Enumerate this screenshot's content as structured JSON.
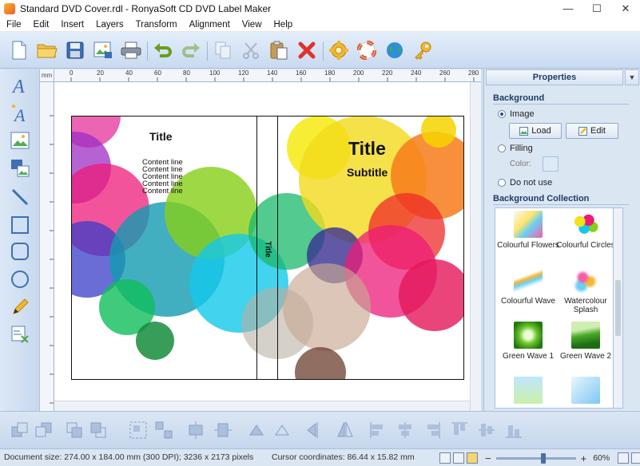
{
  "window": {
    "title": "Standard DVD Cover.rdl - RonyaSoft CD DVD Label Maker",
    "controls": [
      "—",
      "☐",
      "✕"
    ]
  },
  "menu": [
    "File",
    "Edit",
    "Insert",
    "Layers",
    "Transform",
    "Alignment",
    "View",
    "Help"
  ],
  "toolbar": {
    "items": [
      "new-document-icon",
      "open-folder-icon",
      "save-icon",
      "image-export-icon",
      "print-icon",
      "undo-icon",
      "redo-icon",
      "copy-icon",
      "cut-icon",
      "paste-icon",
      "delete-icon",
      "settings-icon",
      "help-lifebuoy-icon",
      "web-globe-icon",
      "key-register-icon"
    ]
  },
  "left_tools": [
    "text-tool-icon",
    "curved-text-tool-icon",
    "image-tool-icon",
    "picture-collection-tool-icon",
    "line-tool-icon",
    "rectangle-tool-icon",
    "rounded-rectangle-tool-icon",
    "ellipse-tool-icon",
    "pencil-tool-icon",
    "clipart-tool-icon"
  ],
  "ruler": {
    "unit": "mm",
    "h_ticks": [
      "0",
      "20",
      "40",
      "60",
      "80",
      "100",
      "120",
      "140",
      "160",
      "180",
      "200",
      "220",
      "240",
      "260",
      "280"
    ],
    "v_ticks": [
      "0",
      "20",
      "40",
      "60",
      "80",
      "100",
      "120",
      "140",
      "160",
      "180",
      "200"
    ]
  },
  "cover": {
    "back_title": "Title",
    "content_lines": [
      "Content line",
      "Content line",
      "Content line",
      "Content line",
      "Content line"
    ],
    "spine_title": "Title",
    "front_title": "Title",
    "front_subtitle": "Subtitle"
  },
  "properties": {
    "header": "Properties",
    "background_label": "Background",
    "option_image": "Image",
    "load_button": "Load",
    "edit_button": "Edit",
    "option_filling": "Filling",
    "color_label": "Color:",
    "option_none": "Do not use",
    "collection_label": "Background Collection",
    "collection": [
      {
        "name": "Colourful Flowers"
      },
      {
        "name": "Colourful Circles"
      },
      {
        "name": "Colourful Wave"
      },
      {
        "name": "Watercolour Splash"
      },
      {
        "name": "Green Wave 1"
      },
      {
        "name": "Green Wave 2"
      }
    ]
  },
  "bottom_tools": [
    "bring-to-front-icon",
    "send-to-back-icon",
    "bring-forward-icon",
    "send-backward-icon",
    "group-icon",
    "ungroup-icon",
    "center-horizontal-icon",
    "center-vertical-icon",
    "rotate-left-icon",
    "rotate-right-icon",
    "flip-horizontal-icon",
    "flip-vertical-icon",
    "align-left-icon",
    "align-center-icon",
    "align-right-icon",
    "align-top-icon",
    "align-middle-icon",
    "align-bottom-icon"
  ],
  "status": {
    "document_size": "Document size: 274.00 x 184.00 mm (300 DPI); 3236 x 2173 pixels",
    "cursor": "Cursor coordinates: 86.44 x 15.82 mm",
    "zoom": "60%",
    "zoom_minus": "−",
    "zoom_plus": "+",
    "zoom_level": 0.6
  },
  "colors": {
    "accent": "#1c3b66",
    "panel": "#dbe6f3",
    "toolbar": "#c9daf0"
  }
}
